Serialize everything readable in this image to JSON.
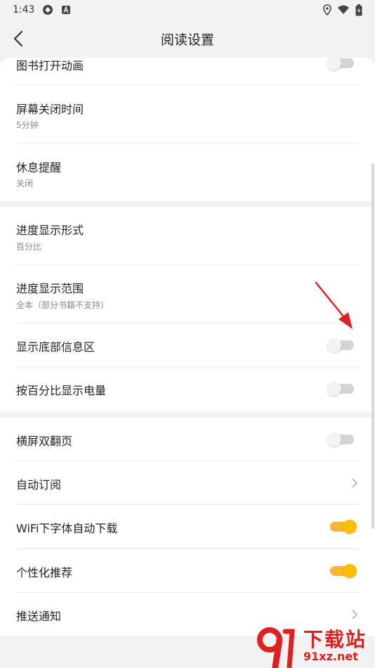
{
  "status_bar": {
    "time": "1:43"
  },
  "header": {
    "title": "阅读设置"
  },
  "sections": [
    {
      "rows": [
        {
          "title": "图书打开动画",
          "control": "toggle",
          "state": "off"
        },
        {
          "title": "屏幕关闭时间",
          "subtitle": "5分钟",
          "control": "none"
        },
        {
          "title": "休息提醒",
          "subtitle": "关闭",
          "control": "none"
        }
      ]
    },
    {
      "rows": [
        {
          "title": "进度显示形式",
          "subtitle": "百分比",
          "control": "none"
        },
        {
          "title": "进度显示范围",
          "subtitle": "全本（部分书籍不支持）",
          "control": "none"
        },
        {
          "title": "显示底部信息区",
          "control": "toggle",
          "state": "off"
        },
        {
          "title": "按百分比显示电量",
          "control": "toggle",
          "state": "off"
        }
      ]
    },
    {
      "rows": [
        {
          "title": "横屏双翻页",
          "control": "toggle",
          "state": "off"
        },
        {
          "title": "自动订阅",
          "control": "chevron"
        },
        {
          "title": "WiFi下字体自动下载",
          "control": "toggle",
          "state": "on"
        },
        {
          "title": "个性化推荐",
          "control": "toggle",
          "state": "on"
        },
        {
          "title": "推送通知",
          "control": "chevron"
        }
      ]
    }
  ],
  "watermark": {
    "title": "下载站",
    "sub": "91xz.net"
  },
  "colors": {
    "accent": "#f9be00",
    "toggle_off": "#d4d4d4",
    "annotation": "#e02020"
  },
  "icons": [
    "back-arrow-icon",
    "chevron-right-icon",
    "location-icon",
    "wifi-icon",
    "battery-icon"
  ]
}
